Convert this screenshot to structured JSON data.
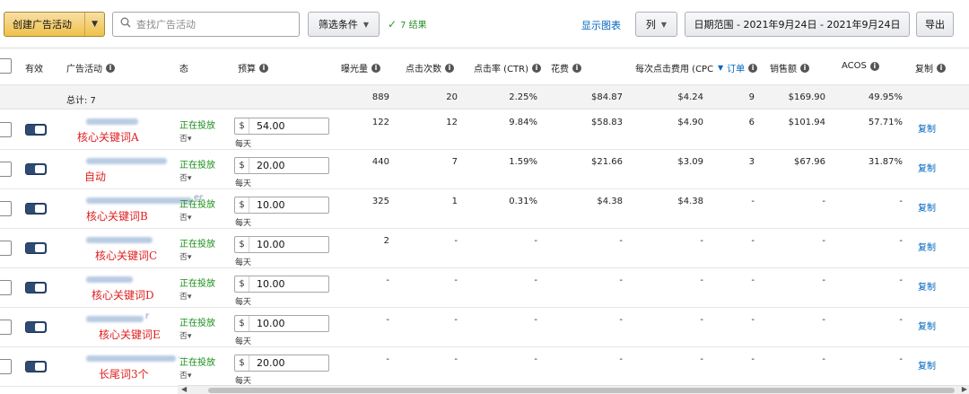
{
  "toolbar": {
    "create_label": "创建广告活动",
    "search_placeholder": "查找广告活动",
    "filter_label": "筛选条件",
    "results_text": "7 结果",
    "show_chart_label": "显示图表",
    "columns_label": "列",
    "date_range_label": "日期范围 - 2021年9月24日 - 2021年9月24日",
    "export_label": "导出"
  },
  "table": {
    "headers": {
      "active": "有效",
      "campaign": "广告活动",
      "status": "态",
      "budget": "预算",
      "impressions": "曝光量",
      "clicks": "点击次数",
      "ctr": "点击率 (CTR)",
      "spend": "花费",
      "cpc": "每次点击费用 (CPC",
      "orders": "订单",
      "sales": "销售额",
      "acos": "ACOS",
      "copy": "复制"
    },
    "totals": {
      "label": "总计: 7",
      "impressions": "889",
      "clicks": "20",
      "ctr": "2.25%",
      "spend": "$84.87",
      "cpc": "$4.24",
      "orders": "9",
      "sales": "$169.90",
      "acos": "49.95%"
    },
    "rows": [
      {
        "note": "核心关键词A",
        "name_suffix": "",
        "status": "正在投放",
        "sub": "否▾",
        "currency": "$",
        "budget": "54.00",
        "per": "每天",
        "impressions": "122",
        "clicks": "12",
        "ctr": "9.84%",
        "spend": "$58.83",
        "cpc": "$4.90",
        "orders": "6",
        "sales": "$101.94",
        "acos": "57.71%",
        "copy": "复制"
      },
      {
        "note": "自动",
        "name_suffix": "",
        "status": "正在投放",
        "sub": "否▾",
        "currency": "$",
        "budget": "20.00",
        "per": "每天",
        "impressions": "440",
        "clicks": "7",
        "ctr": "1.59%",
        "spend": "$21.66",
        "cpc": "$3.09",
        "orders": "3",
        "sales": "$67.96",
        "acos": "31.87%",
        "copy": "复制"
      },
      {
        "note": "核心关键词B",
        "name_suffix": "er",
        "status": "正在投放",
        "sub": "否▾",
        "currency": "$",
        "budget": "10.00",
        "per": "每天",
        "impressions": "325",
        "clicks": "1",
        "ctr": "0.31%",
        "spend": "$4.38",
        "cpc": "$4.38",
        "orders": "-",
        "sales": "-",
        "acos": "-",
        "copy": "复制"
      },
      {
        "note": "核心关键词C",
        "name_suffix": "",
        "status": "正在投放",
        "sub": "否▾",
        "currency": "$",
        "budget": "10.00",
        "per": "每天",
        "impressions": "2",
        "clicks": "-",
        "ctr": "-",
        "spend": "-",
        "cpc": "-",
        "orders": "-",
        "sales": "-",
        "acos": "-",
        "copy": "复制"
      },
      {
        "note": "核心关键词D",
        "name_suffix": "",
        "status": "正在投放",
        "sub": "否▾",
        "currency": "$",
        "budget": "10.00",
        "per": "每天",
        "impressions": "-",
        "clicks": "-",
        "ctr": "-",
        "spend": "-",
        "cpc": "-",
        "orders": "-",
        "sales": "-",
        "acos": "-",
        "copy": "复制"
      },
      {
        "note": "核心关键词E",
        "name_suffix": "r",
        "status": "正在投放",
        "sub": "否▾",
        "currency": "$",
        "budget": "10.00",
        "per": "每天",
        "impressions": "-",
        "clicks": "-",
        "ctr": "-",
        "spend": "-",
        "cpc": "-",
        "orders": "-",
        "sales": "-",
        "acos": "-",
        "copy": "复制"
      },
      {
        "note": "长尾词3个",
        "name_suffix": "...",
        "status": "正在投放",
        "sub": "否▾",
        "currency": "$",
        "budget": "20.00",
        "per": "每天",
        "impressions": "-",
        "clicks": "-",
        "ctr": "-",
        "spend": "-",
        "cpc": "-",
        "orders": "-",
        "sales": "-",
        "acos": "-",
        "copy": "复制"
      }
    ]
  }
}
